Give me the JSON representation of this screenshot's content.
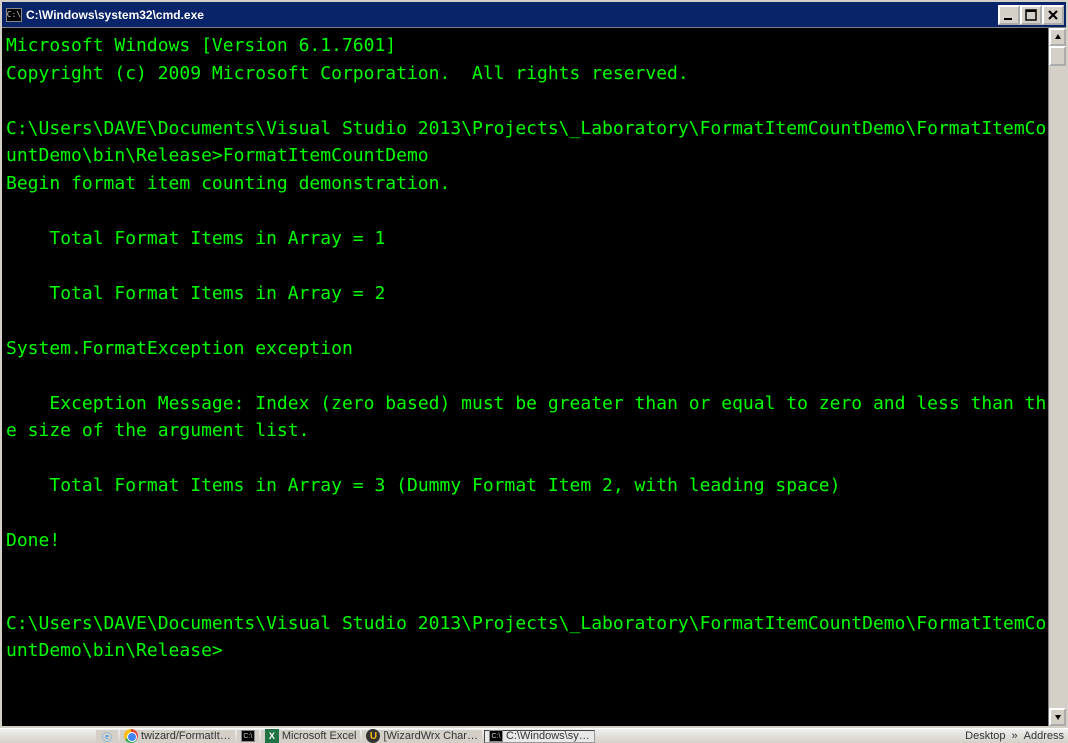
{
  "window": {
    "title": "C:\\Windows\\system32\\cmd.exe"
  },
  "console": {
    "lines": [
      "Microsoft Windows [Version 6.1.7601]",
      "Copyright (c) 2009 Microsoft Corporation.  All rights reserved.",
      "",
      "C:\\Users\\DAVE\\Documents\\Visual Studio 2013\\Projects\\_Laboratory\\FormatItemCountDemo\\FormatItemCountDemo\\bin\\Release>FormatItemCountDemo",
      "Begin format item counting demonstration.",
      "",
      "    Total Format Items in Array = 1",
      "",
      "    Total Format Items in Array = 2",
      "",
      "System.FormatException exception",
      "",
      "    Exception Message: Index (zero based) must be greater than or equal to zero and less than the size of the argument list.",
      "",
      "    Total Format Items in Array = 3 (Dummy Format Item 2, with leading space)",
      "",
      "Done!",
      "",
      "",
      "C:\\Users\\DAVE\\Documents\\Visual Studio 2013\\Projects\\_Laboratory\\FormatItemCountDemo\\FormatItemCountDemo\\bin\\Release>"
    ]
  },
  "taskbar": {
    "items": [
      {
        "label": "twizard/FormatIt…"
      },
      {
        "label": ""
      },
      {
        "label": "Microsoft Excel"
      },
      {
        "label": "[WizardWrx Char…"
      },
      {
        "label": "C:\\Windows\\sy…"
      }
    ],
    "right": {
      "desktop": "Desktop",
      "address": "Address"
    }
  }
}
